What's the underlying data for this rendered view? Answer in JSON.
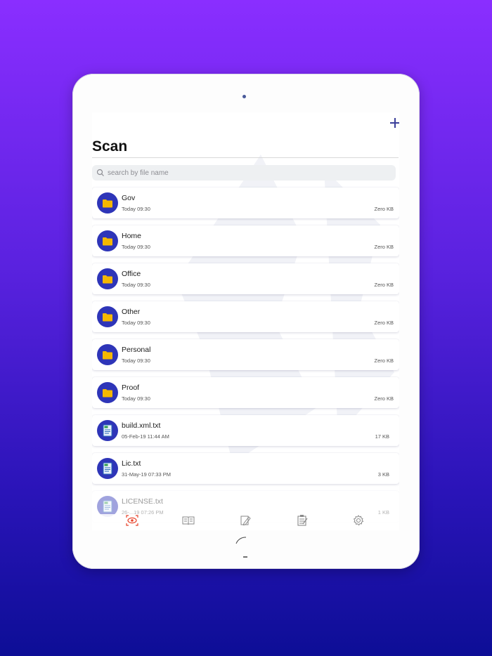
{
  "header": {
    "title": "Scan",
    "add_icon": "plus-icon"
  },
  "search": {
    "placeholder": "search by file name",
    "value": "",
    "icon": "search-icon"
  },
  "items": [
    {
      "type": "folder",
      "name": "Gov",
      "date": "Today 09:30",
      "size": "Zero KB"
    },
    {
      "type": "folder",
      "name": "Home",
      "date": "Today 09:30",
      "size": "Zero KB"
    },
    {
      "type": "folder",
      "name": "Office",
      "date": "Today 09:30",
      "size": "Zero KB"
    },
    {
      "type": "folder",
      "name": "Other",
      "date": "Today 09:30",
      "size": "Zero KB"
    },
    {
      "type": "folder",
      "name": "Personal",
      "date": "Today 09:30",
      "size": "Zero KB"
    },
    {
      "type": "folder",
      "name": "Proof",
      "date": "Today 09:30",
      "size": "Zero KB"
    },
    {
      "type": "file",
      "name": "build.xml.txt",
      "date": "05-Feb-19 11:44 AM",
      "size": "17 KB"
    },
    {
      "type": "file",
      "name": "Lic.txt",
      "date": "31-May-19 07:33 PM",
      "size": "3 KB"
    },
    {
      "type": "file",
      "name": "LICENSE.txt",
      "date": "26-...19 07:26 PM",
      "size": "1 KB"
    }
  ],
  "tabbar": {
    "tabs": [
      {
        "icon": "scan-eye-icon",
        "active": true
      },
      {
        "icon": "book-icon",
        "active": false
      },
      {
        "icon": "document-edit-icon",
        "active": false
      },
      {
        "icon": "clipboard-icon",
        "active": false
      },
      {
        "icon": "settings-gear-icon",
        "active": false
      }
    ]
  },
  "colors": {
    "accent": "#2e35b8",
    "folder": "#f5b800",
    "active_tab": "#e8452c",
    "inactive_tab": "#8a8a8a"
  }
}
